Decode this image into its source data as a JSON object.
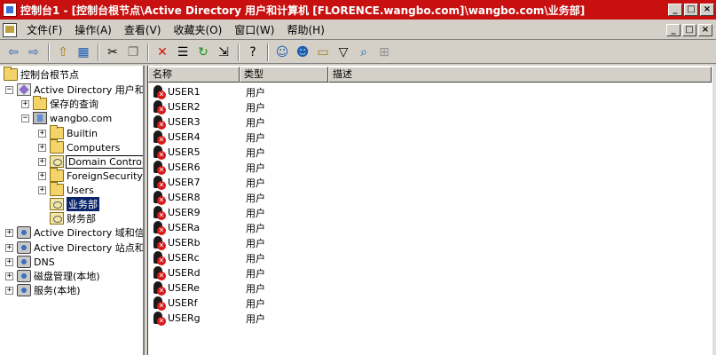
{
  "window": {
    "title": "控制台1 - [控制台根节点\\Active Directory 用户和计算机 [FLORENCE.wangbo.com]\\wangbo.com\\业务部]",
    "min_label": "_",
    "max_label": "□",
    "close_label": "×"
  },
  "menu": {
    "items": [
      "文件(F)",
      "操作(A)",
      "查看(V)",
      "收藏夹(O)",
      "窗口(W)",
      "帮助(H)"
    ]
  },
  "toolbar": {
    "icons": [
      "back-icon",
      "forward-icon",
      "up-folder-icon",
      "show-tree-icon",
      "cut-icon",
      "copy-icon",
      "delete-icon",
      "properties-icon",
      "refresh-icon",
      "export-icon",
      "help-icon",
      "new-user-icon",
      "new-group-icon",
      "new-ou-icon",
      "filter-icon",
      "find-icon",
      "add-to-group-icon"
    ]
  },
  "tree": {
    "root": "控制台根节点",
    "aduc": "Active Directory 用户和计算机",
    "saved_queries": "保存的查询",
    "domain": "wangbo.com",
    "builtin": "Builtin",
    "computers": "Computers",
    "domain_controllers": "Domain Controllers",
    "fsp": "ForeignSecurityPrincipals",
    "users": "Users",
    "yewubu": "业务部",
    "caiwubu": "财务部",
    "ad_domains": "Active Directory 域和信任关系",
    "ad_sites": "Active Directory 站点和服务",
    "dns": "DNS",
    "disk": "磁盘管理(本地)",
    "services": "服务(本地)"
  },
  "list": {
    "columns": [
      "名称",
      "类型",
      "描述"
    ],
    "rows": [
      {
        "name": "USER1",
        "type": "用户"
      },
      {
        "name": "USER2",
        "type": "用户"
      },
      {
        "name": "USER3",
        "type": "用户"
      },
      {
        "name": "USER4",
        "type": "用户"
      },
      {
        "name": "USER5",
        "type": "用户"
      },
      {
        "name": "USER6",
        "type": "用户"
      },
      {
        "name": "USER7",
        "type": "用户"
      },
      {
        "name": "USER8",
        "type": "用户"
      },
      {
        "name": "USER9",
        "type": "用户"
      },
      {
        "name": "USERa",
        "type": "用户"
      },
      {
        "name": "USERb",
        "type": "用户"
      },
      {
        "name": "USERc",
        "type": "用户"
      },
      {
        "name": "USERd",
        "type": "用户"
      },
      {
        "name": "USERe",
        "type": "用户"
      },
      {
        "name": "USERf",
        "type": "用户"
      },
      {
        "name": "USERg",
        "type": "用户"
      }
    ]
  },
  "colors": {
    "titlebar": "#c81010",
    "selection": "#0a246a",
    "disabled_user_badge": "#d81818"
  }
}
